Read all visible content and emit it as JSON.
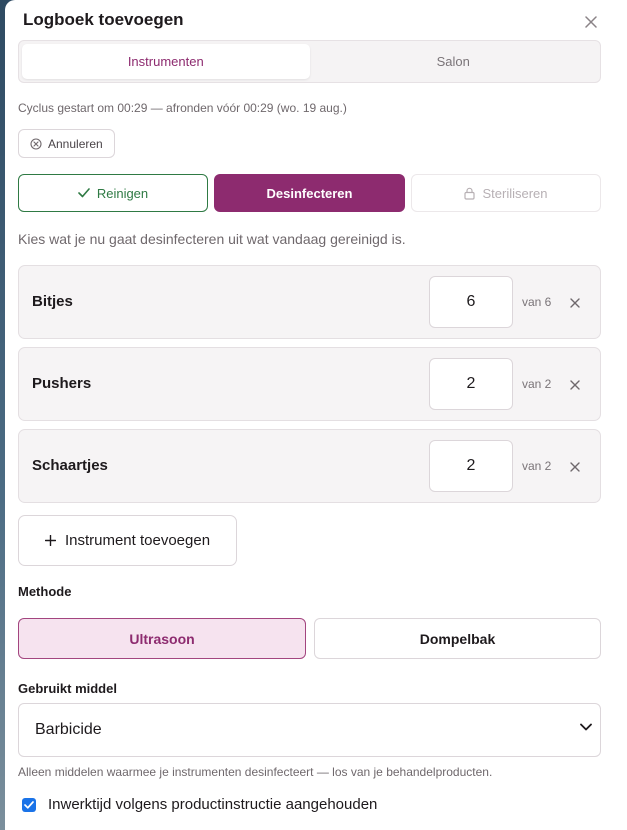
{
  "dialog": {
    "title": "Logboek toevoegen",
    "tabs": [
      {
        "label": "Instrumenten",
        "active": true
      },
      {
        "label": "Salon",
        "active": false
      }
    ],
    "cycle_text": "Cyclus gestart om 00:29 — afronden vóór 00:29 (wo. 19 aug.)",
    "cancel_label": "Annuleren"
  },
  "steps": {
    "clean": {
      "label": "Reinigen",
      "state": "done"
    },
    "disinfect": {
      "label": "Desinfecteren",
      "state": "active"
    },
    "sterilize": {
      "label": "Steriliseren",
      "state": "locked"
    }
  },
  "hint": "Kies wat je nu gaat desinfecteren uit wat vandaag gereinigd is.",
  "items": [
    {
      "name": "Bitjes",
      "quantity": "6",
      "of_label": "van 6"
    },
    {
      "name": "Pushers",
      "quantity": "2",
      "of_label": "van 2"
    },
    {
      "name": "Schaartjes",
      "quantity": "2",
      "of_label": "van 2"
    }
  ],
  "add_instrument_label": "Instrument toevoegen",
  "method": {
    "label": "Methode",
    "options": [
      {
        "label": "Ultrasoon",
        "selected": true
      },
      {
        "label": "Dompelbak",
        "selected": false
      }
    ]
  },
  "agent": {
    "label": "Gebruikt middel",
    "selected": "Barbicide",
    "help": "Alleen middelen waarmee je instrumenten desinfecteert — los van je behandelproducten."
  },
  "contact_time": {
    "label": "Inwerktijd volgens productinstructie aangehouden",
    "checked": true
  },
  "colors": {
    "accent": "#8d2b6f",
    "accent_light": "#f6e3ef",
    "success": "#2f7a44",
    "checkbox": "#1a73e8"
  },
  "icons": [
    "close-icon",
    "cancel-circle-icon",
    "check-icon",
    "lock-icon",
    "plus-icon",
    "chevron-down-icon",
    "checkmark-icon"
  ]
}
